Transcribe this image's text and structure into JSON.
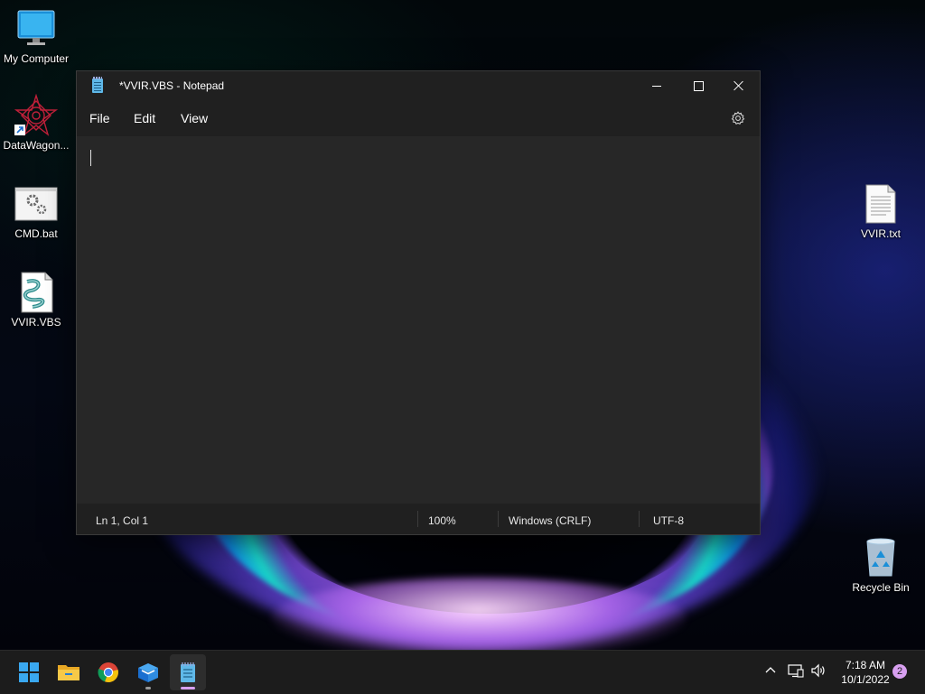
{
  "desktop": {
    "icons": [
      {
        "label": "My Computer",
        "icon": "monitor-icon"
      },
      {
        "label": "DataWagon...",
        "icon": "star-shortcut-icon"
      },
      {
        "label": "CMD.bat",
        "icon": "batch-file-icon"
      },
      {
        "label": "VVIR.VBS",
        "icon": "vbs-script-icon"
      },
      {
        "label": "VVIR.txt",
        "icon": "text-file-icon"
      },
      {
        "label": "Recycle Bin",
        "icon": "recycle-bin-icon"
      }
    ]
  },
  "notepad": {
    "title": "*VVIR.VBS - Notepad",
    "menu": {
      "file": "File",
      "edit": "Edit",
      "view": "View"
    },
    "content": "",
    "status": {
      "position": "Ln 1, Col 1",
      "zoom": "100%",
      "line_endings": "Windows (CRLF)",
      "encoding": "UTF-8"
    }
  },
  "taskbar": {
    "apps": [
      "Start",
      "File Explorer",
      "Google Chrome",
      "App",
      "Notepad"
    ],
    "clock": {
      "time": "7:18 AM",
      "date": "10/1/2022"
    },
    "notifications": "2"
  },
  "colors": {
    "window_bg": "#202020",
    "editor_bg": "#272727",
    "taskbar_bg": "#1c1c1c",
    "accent": "#d8a0f0"
  }
}
